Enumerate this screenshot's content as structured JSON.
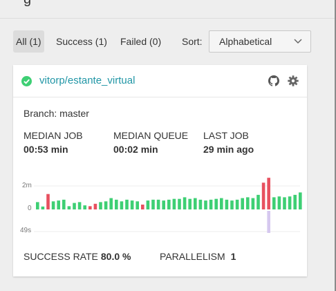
{
  "page_title_fragment": "g",
  "filters": [
    {
      "label": "All (1)",
      "active": true
    },
    {
      "label": "Success (1)",
      "active": false
    },
    {
      "label": "Failed (0)",
      "active": false
    }
  ],
  "sort": {
    "label": "Sort:",
    "selected": "Alphabetical"
  },
  "repo": {
    "name": "vitorp/estante_virtual",
    "status": "success",
    "branch_text": "Branch: master",
    "stats": [
      {
        "label": "MEDIAN JOB",
        "value": "00:53 min"
      },
      {
        "label": "MEDIAN QUEUE",
        "value": "00:02 min"
      },
      {
        "label": "LAST JOB",
        "value": "29 min ago"
      }
    ],
    "success_rate_label": "SUCCESS RATE",
    "success_rate_value": "80.0 %",
    "parallelism_label": "PARALLELISM",
    "parallelism_value": "1"
  },
  "colors": {
    "success": "#3ecf74",
    "failed": "#e8505f",
    "queue": "#d6c8ef",
    "link": "#2196a6"
  },
  "chart_data": {
    "type": "bar",
    "y_tick_labels": [
      "2m",
      "0",
      "49s"
    ],
    "ylim_job_seconds": [
      0,
      150
    ],
    "series": [
      {
        "values": [
          45,
          18,
          95,
          50,
          55,
          60,
          20,
          40,
          45,
          25,
          20,
          35,
          45,
          50,
          70,
          60,
          50,
          60,
          55,
          50,
          30,
          55,
          60,
          60,
          55,
          60,
          65,
          65,
          75,
          65,
          70,
          60,
          55,
          60,
          65,
          70,
          60,
          55,
          60,
          70,
          75,
          70,
          90,
          165,
          195,
          75,
          80,
          75,
          80,
          90,
          105
        ],
        "status": [
          "s",
          "s",
          "f",
          "s",
          "s",
          "s",
          "s",
          "s",
          "s",
          "s",
          "f",
          "f",
          "s",
          "s",
          "s",
          "s",
          "s",
          "s",
          "s",
          "s",
          "f",
          "s",
          "s",
          "s",
          "s",
          "s",
          "s",
          "s",
          "s",
          "s",
          "s",
          "s",
          "s",
          "s",
          "s",
          "s",
          "s",
          "s",
          "s",
          "s",
          "s",
          "s",
          "s",
          "f",
          "f",
          "s",
          "s",
          "s",
          "s",
          "s",
          "s"
        ]
      },
      {
        "values": [
          0,
          0,
          0,
          0,
          0,
          0,
          0,
          0,
          0,
          0,
          0,
          0,
          0,
          0,
          0,
          0,
          0,
          0,
          0,
          0,
          0,
          0,
          0,
          0,
          0,
          0,
          0,
          0,
          0,
          0,
          0,
          0,
          0,
          0,
          0,
          0,
          0,
          0,
          0,
          0,
          0,
          0,
          0,
          0,
          49,
          0,
          0,
          0,
          0,
          0,
          0
        ]
      }
    ]
  }
}
